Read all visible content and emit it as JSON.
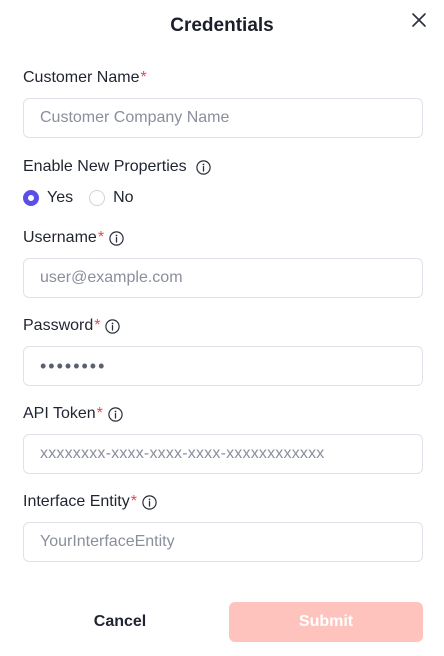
{
  "dialog": {
    "title": "Credentials",
    "close_icon": "close-icon"
  },
  "form": {
    "customer_name": {
      "label": "Customer Name",
      "required": "*",
      "placeholder": "Customer Company Name",
      "value": ""
    },
    "enable_new_properties": {
      "label": "Enable New Properties",
      "info_icon": "info-icon",
      "options": [
        {
          "label": "Yes",
          "selected": true
        },
        {
          "label": "No",
          "selected": false
        }
      ]
    },
    "username": {
      "label": "Username",
      "required": "*",
      "info_icon": "info-icon",
      "placeholder": "user@example.com",
      "value": ""
    },
    "password": {
      "label": "Password",
      "required": "*",
      "info_icon": "info-icon",
      "value": "••••••••"
    },
    "api_token": {
      "label": "API Token",
      "required": "*",
      "info_icon": "info-icon",
      "placeholder": "xxxxxxxx-xxxx-xxxx-xxxx-xxxxxxxxxxxx",
      "value": ""
    },
    "interface_entity": {
      "label": "Interface Entity",
      "required": "*",
      "info_icon": "info-icon",
      "placeholder": "YourInterfaceEntity",
      "value": ""
    }
  },
  "actions": {
    "cancel_label": "Cancel",
    "submit_label": "Submit"
  },
  "colors": {
    "accent": "#5b4fe9",
    "required": "#e5484d",
    "submit_disabled": "#ffc3bd"
  }
}
